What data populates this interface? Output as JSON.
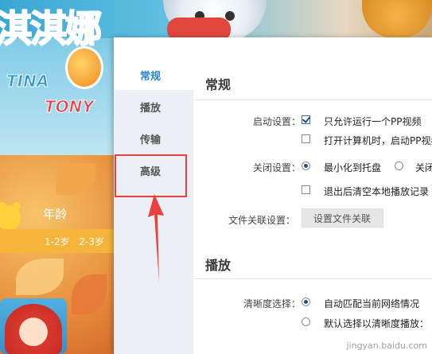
{
  "background": {
    "logo_text": "淇淇娜",
    "logo_sub_1": "TINA",
    "logo_sub_2": "TONY",
    "age_title": "年龄",
    "age_values": "1-2岁 2-3岁"
  },
  "dialog": {
    "nav": {
      "items": [
        {
          "label": "常规",
          "active": true
        },
        {
          "label": "播放",
          "active": false
        },
        {
          "label": "传输",
          "active": false
        },
        {
          "label": "高级",
          "active": false
        }
      ]
    },
    "general": {
      "title": "常规",
      "startup_label": "启动设置：",
      "startup_opt1": "只允许运行一个PP视频",
      "startup_opt1_checked": true,
      "startup_opt2": "打开计算机时，启动PP视频",
      "startup_opt2_checked": false,
      "close_label": "关闭设置：",
      "close_opt1": "最小化到托盘",
      "close_opt1_selected": true,
      "close_opt2": "关闭",
      "close_opt2_selected": false,
      "clear_history": "退出后清空本地播放记录",
      "clear_history_checked": false,
      "file_assoc_label": "文件关联设置：",
      "file_assoc_button": "设置文件关联"
    },
    "playback": {
      "title": "播放",
      "quality_label": "清晰度选择：",
      "quality_opt1": "自动匹配当前网络情况",
      "quality_opt1_selected": true,
      "quality_opt2": "默认选择以清晰度播放：",
      "quality_opt2_selected": false
    }
  },
  "annotation": {
    "highlight_color": "#e8403b"
  },
  "watermark": "jingyan.baidu.com"
}
